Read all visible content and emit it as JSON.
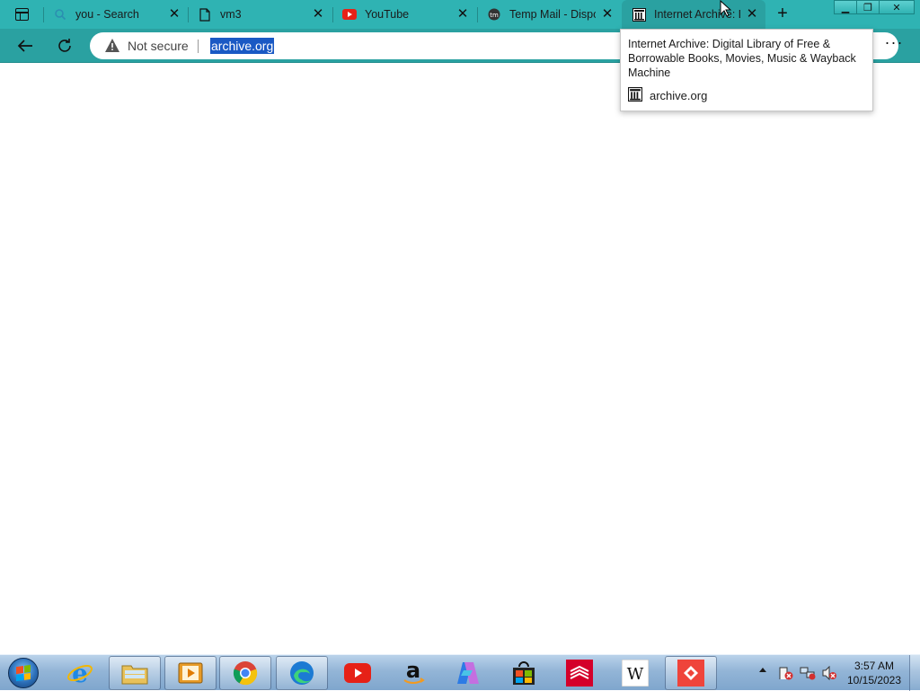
{
  "browser": {
    "tabs": [
      {
        "title": "you - Search",
        "favicon": "search-icon"
      },
      {
        "title": "vm3",
        "favicon": "document-icon"
      },
      {
        "title": "YouTube",
        "favicon": "youtube-icon"
      },
      {
        "title": "Temp Mail - Dispo",
        "favicon": "tempmail-icon"
      },
      {
        "title": "Internet Archive: D",
        "favicon": "archive-icon",
        "active": true
      }
    ],
    "window_controls": [
      "minimize",
      "restore",
      "close"
    ]
  },
  "toolbar": {
    "security_label": "Not secure",
    "url": "archive.org"
  },
  "hovercard": {
    "title": "Internet Archive: Digital Library of Free & Borrowable Books, Movies, Music & Wayback Machine",
    "url": "archive.org"
  },
  "taskbar": {
    "apps": [
      "internet-explorer",
      "file-explorer",
      "media-player",
      "chrome",
      "edge",
      "youtube",
      "amazon",
      "copilot",
      "store",
      "bank-of-america",
      "wikipedia",
      "anydesk"
    ],
    "clock": {
      "time": "3:57 AM",
      "date": "10/15/2023"
    }
  },
  "colors": {
    "accent": "#2fb3b3",
    "selection": "#1a59c4"
  }
}
